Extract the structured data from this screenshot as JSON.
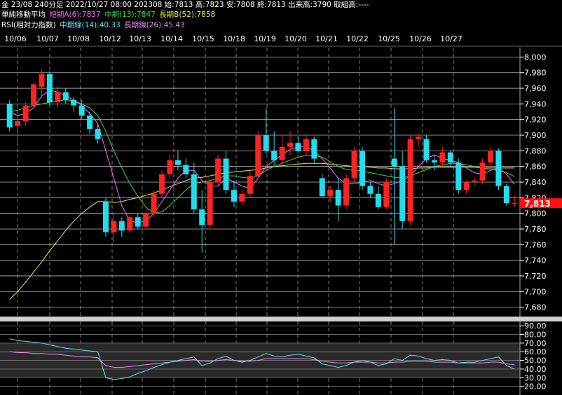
{
  "header": {
    "line1": "金 23/08 240分足 2022/10/27 08:00 202308 始:7813 高:7823 安:7808 終:7813 出来高:3790 取組高:----",
    "ma_title": "単純移動平均",
    "ma_short": "短期A(6):7837",
    "ma_mid": "中期(13):7847",
    "ma_long": "長期B(52):7858",
    "rsi_title": "RSI(相対力指数)",
    "rsi_mid": "中期線(14):40.33",
    "rsi_long": "長期線(26):45.43"
  },
  "colors": {
    "up": "#ff2222",
    "down": "#22ddee",
    "ma_short": "#ff66ff",
    "ma_mid": "#33dd33",
    "ma_long": "#e8e84a",
    "rsi_mid": "#5fe3f0",
    "rsi_long": "#e48ae4",
    "price_tag": "#ff1010"
  },
  "chart_data": [
    {
      "type": "candlestick",
      "x_labels": [
        "10/06",
        "10/07",
        "10/08",
        "10/12",
        "10/13",
        "10/14",
        "10/15",
        "10/18",
        "10/19",
        "10/20",
        "10/21",
        "10/22",
        "10/25",
        "10/26",
        "10/27"
      ],
      "y_ticks": [
        "8,000",
        "7,980",
        "7,960",
        "7,940",
        "7,920",
        "7,900",
        "7,880",
        "7,860",
        "7,840",
        "7,820",
        "7,800",
        "7,780",
        "7,760",
        "7,740",
        "7,720",
        "7,700",
        "7,680"
      ],
      "ylim": [
        7668,
        8012
      ],
      "last_price": "7,813",
      "ohlc": [
        [
          7940,
          7945,
          7905,
          7910
        ],
        [
          7912,
          7930,
          7890,
          7918
        ],
        [
          7918,
          7942,
          7912,
          7938
        ],
        [
          7938,
          7968,
          7935,
          7965
        ],
        [
          7962,
          7985,
          7948,
          7978
        ],
        [
          7978,
          7982,
          7938,
          7942
        ],
        [
          7942,
          7962,
          7935,
          7955
        ],
        [
          7955,
          7960,
          7940,
          7945
        ],
        [
          7945,
          7948,
          7930,
          7938
        ],
        [
          7938,
          7945,
          7920,
          7925
        ],
        [
          7925,
          7930,
          7902,
          7908
        ],
        [
          7908,
          7915,
          7890,
          7895
        ],
        [
          7815,
          7820,
          7770,
          7776
        ],
        [
          7776,
          7800,
          7762,
          7790
        ],
        [
          7790,
          7795,
          7770,
          7778
        ],
        [
          7778,
          7800,
          7775,
          7795
        ],
        [
          7795,
          7800,
          7780,
          7783
        ],
        [
          7783,
          7805,
          7780,
          7800
        ],
        [
          7800,
          7830,
          7795,
          7825
        ],
        [
          7825,
          7855,
          7820,
          7850
        ],
        [
          7850,
          7875,
          7845,
          7868
        ],
        [
          7868,
          7880,
          7855,
          7862
        ],
        [
          7862,
          7870,
          7845,
          7850
        ],
        [
          7850,
          7865,
          7800,
          7805
        ],
        [
          7805,
          7830,
          7750,
          7785
        ],
        [
          7785,
          7845,
          7780,
          7840
        ],
        [
          7840,
          7875,
          7835,
          7870
        ],
        [
          7870,
          7880,
          7825,
          7830
        ],
        [
          7830,
          7842,
          7808,
          7815
        ],
        [
          7815,
          7830,
          7810,
          7825
        ],
        [
          7825,
          7855,
          7820,
          7848
        ],
        [
          7848,
          7905,
          7845,
          7900
        ],
        [
          7900,
          7935,
          7875,
          7880
        ],
        [
          7880,
          7905,
          7860,
          7868
        ],
        [
          7868,
          7900,
          7860,
          7885
        ],
        [
          7885,
          7905,
          7875,
          7890
        ],
        [
          7890,
          7898,
          7878,
          7880
        ],
        [
          7880,
          7900,
          7875,
          7895
        ],
        [
          7895,
          7898,
          7865,
          7870
        ],
        [
          7845,
          7850,
          7820,
          7822
        ],
        [
          7822,
          7835,
          7815,
          7830
        ],
        [
          7830,
          7845,
          7790,
          7810
        ],
        [
          7810,
          7850,
          7805,
          7845
        ],
        [
          7845,
          7885,
          7840,
          7880
        ],
        [
          7880,
          7885,
          7830,
          7835
        ],
        [
          7835,
          7840,
          7820,
          7825
        ],
        [
          7825,
          7835,
          7805,
          7808
        ],
        [
          7808,
          7845,
          7805,
          7840
        ],
        [
          7870,
          7935,
          7760,
          7860
        ],
        [
          7860,
          7880,
          7780,
          7790
        ],
        [
          7790,
          7900,
          7785,
          7895
        ],
        [
          7895,
          7902,
          7885,
          7898
        ],
        [
          7895,
          7900,
          7865,
          7868
        ],
        [
          7868,
          7875,
          7855,
          7865
        ],
        [
          7865,
          7885,
          7860,
          7878
        ],
        [
          7878,
          7880,
          7860,
          7865
        ],
        [
          7865,
          7870,
          7825,
          7830
        ],
        [
          7830,
          7842,
          7825,
          7840
        ],
        [
          7840,
          7845,
          7835,
          7842
        ],
        [
          7842,
          7870,
          7838,
          7865
        ],
        [
          7865,
          7885,
          7860,
          7880
        ],
        [
          7880,
          7883,
          7830,
          7835
        ],
        [
          7835,
          7838,
          7810,
          7813
        ],
        [
          7813,
          7823,
          7808,
          7813
        ]
      ],
      "ma_short": [
        7930,
        7925,
        7928,
        7935,
        7950,
        7958,
        7955,
        7950,
        7945,
        7938,
        7928,
        7915,
        7880,
        7845,
        7810,
        7790,
        7788,
        7790,
        7800,
        7815,
        7830,
        7845,
        7855,
        7855,
        7842,
        7835,
        7835,
        7845,
        7840,
        7835,
        7832,
        7845,
        7860,
        7868,
        7875,
        7882,
        7885,
        7885,
        7880,
        7870,
        7858,
        7845,
        7838,
        7838,
        7840,
        7842,
        7838,
        7835,
        7838,
        7842,
        7848,
        7860,
        7870,
        7875,
        7870,
        7868,
        7865,
        7858,
        7852,
        7850,
        7855,
        7858,
        7850,
        7837
      ],
      "ma_mid": [
        7930,
        7932,
        7935,
        7938,
        7940,
        7942,
        7944,
        7945,
        7944,
        7940,
        7935,
        7925,
        7905,
        7880,
        7858,
        7838,
        7822,
        7808,
        7800,
        7802,
        7810,
        7820,
        7830,
        7838,
        7840,
        7842,
        7845,
        7848,
        7848,
        7846,
        7845,
        7848,
        7855,
        7860,
        7864,
        7868,
        7872,
        7874,
        7874,
        7872,
        7866,
        7860,
        7856,
        7855,
        7854,
        7852,
        7850,
        7848,
        7846,
        7846,
        7848,
        7852,
        7856,
        7860,
        7862,
        7864,
        7864,
        7862,
        7860,
        7858,
        7856,
        7855,
        7852,
        7847
      ],
      "ma_long": [
        7690,
        7700,
        7712,
        7725,
        7738,
        7752,
        7765,
        7778,
        7790,
        7800,
        7808,
        7815,
        7815,
        7814,
        7815,
        7818,
        7820,
        7823,
        7826,
        7830,
        7834,
        7838,
        7842,
        7845,
        7846,
        7848,
        7850,
        7852,
        7853,
        7854,
        7855,
        7856,
        7858,
        7860,
        7861,
        7862,
        7863,
        7864,
        7864,
        7864,
        7863,
        7862,
        7861,
        7860,
        7860,
        7859,
        7858,
        7858,
        7857,
        7857,
        7857,
        7858,
        7858,
        7859,
        7859,
        7859,
        7859,
        7859,
        7859,
        7858,
        7858,
        7858,
        7858,
        7858
      ]
    },
    {
      "type": "line",
      "y_ticks": [
        "90.00",
        "80.00",
        "70.00",
        "60.00",
        "50.00",
        "40.00",
        "30.00",
        "20.00"
      ],
      "ylim": [
        10,
        95
      ],
      "series_mid": [
        75,
        73,
        72,
        71,
        70,
        68,
        66,
        64,
        63,
        62,
        61,
        60,
        30,
        28,
        29,
        31,
        35,
        38,
        42,
        45,
        48,
        50,
        52,
        54,
        44,
        47,
        52,
        55,
        50,
        48,
        50,
        54,
        58,
        55,
        54,
        56,
        57,
        55,
        53,
        46,
        44,
        42,
        44,
        48,
        50,
        48,
        44,
        46,
        52,
        50,
        56,
        55,
        52,
        50,
        51,
        50,
        47,
        48,
        48,
        50,
        52,
        54,
        44,
        40
      ],
      "series_long": [
        60,
        59,
        59,
        58,
        58,
        57,
        57,
        56,
        55,
        54,
        54,
        53,
        44,
        42,
        42,
        43,
        44,
        45,
        46,
        47,
        48,
        49,
        50,
        51,
        49,
        49,
        50,
        51,
        50,
        49,
        49,
        50,
        52,
        52,
        52,
        52,
        52,
        52,
        51,
        49,
        48,
        47,
        47,
        48,
        48,
        48,
        47,
        47,
        48,
        48,
        49,
        49,
        49,
        48,
        48,
        48,
        47,
        47,
        47,
        47,
        48,
        48,
        46,
        45
      ]
    }
  ]
}
